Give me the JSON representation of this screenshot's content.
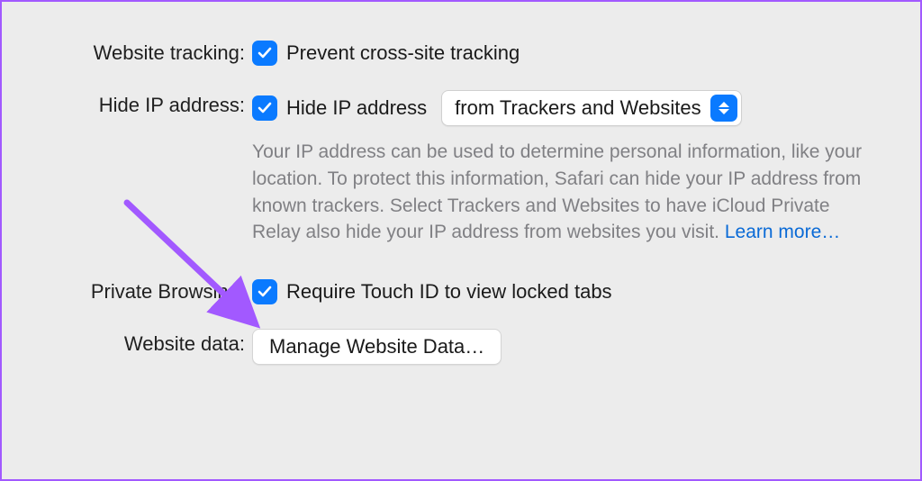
{
  "rows": {
    "website_tracking": {
      "label": "Website tracking:",
      "checkbox_label": "Prevent cross-site tracking",
      "checked": true
    },
    "hide_ip": {
      "label": "Hide IP address:",
      "checkbox_label": "Hide IP address",
      "checked": true,
      "select_value": "from Trackers and Websites",
      "help_text": "Your IP address can be used to determine personal information, like your location. To protect this information, Safari can hide your IP address from known trackers. Select Trackers and Websites to have iCloud Private Relay also hide your IP address from websites you visit. ",
      "learn_more": "Learn more…"
    },
    "private_browsing": {
      "label": "Private Browsing:",
      "checkbox_label": "Require Touch ID to view locked tabs",
      "checked": true
    },
    "website_data": {
      "label": "Website data:",
      "button_label": "Manage Website Data…"
    }
  },
  "colors": {
    "accent": "#0a7aff",
    "annotation": "#a259ff"
  }
}
